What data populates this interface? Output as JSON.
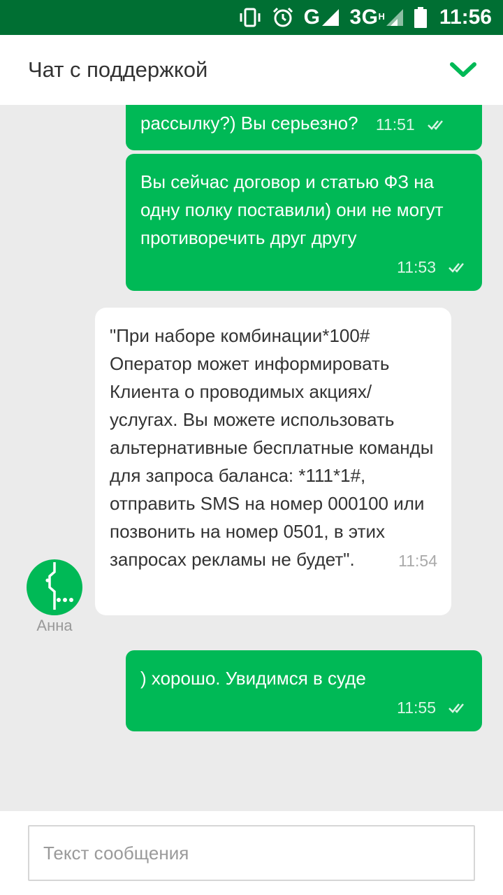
{
  "status_bar": {
    "network_g": "G",
    "network_3g": "3G",
    "network_h": "H",
    "time": "11:56",
    "icons": [
      "vibrate-icon",
      "alarm-icon",
      "signal-icon",
      "signal-icon",
      "battery-icon"
    ]
  },
  "header": {
    "title": "Чат с поддержкой",
    "collapse_icon": "chevron-down-icon"
  },
  "messages": [
    {
      "direction": "outgoing",
      "text": "рассылку?) Вы серьезно?",
      "time": "11:51",
      "status": "read"
    },
    {
      "direction": "outgoing",
      "text": "Вы сейчас договор и статью ФЗ на одну полку поставили) они не могут противоречить друг другу",
      "time": "11:53",
      "status": "read"
    },
    {
      "direction": "incoming",
      "author": "Анна",
      "text": "\"При наборе комбинации*100# Оператор может информировать Клиента о проводимых акциях/услугах. Вы можете использовать альтернативные бесплатные команды для запроса баланса: *111*1#, отправить SMS на номер 000100 или позвонить на номер 0501, в этих запросах рекламы не будет\".",
      "time": "11:54"
    },
    {
      "direction": "outgoing",
      "text": ") хорошо. Увидимся в суде",
      "time": "11:55",
      "status": "read"
    }
  ],
  "input": {
    "placeholder": "Текст сообщения",
    "value": ""
  },
  "colors": {
    "status_bar": "#006f33",
    "accent": "#00b956",
    "background": "#ebebeb"
  }
}
